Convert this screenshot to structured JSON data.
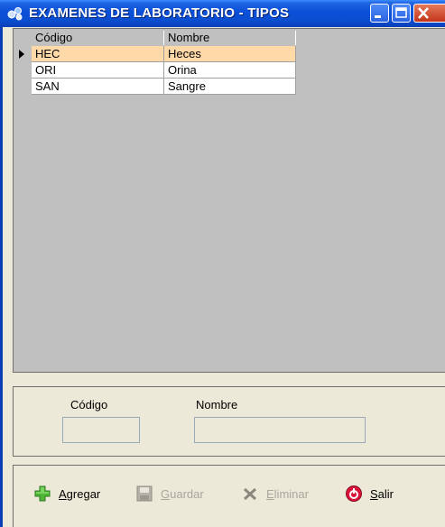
{
  "window": {
    "title": "EXAMENES DE LABORATORIO - TIPOS"
  },
  "grid": {
    "columns": [
      "Código",
      "Nombre"
    ],
    "rows": [
      {
        "codigo": "HEC",
        "nombre": "Heces",
        "selected": true
      },
      {
        "codigo": "ORI",
        "nombre": "Orina",
        "selected": false
      },
      {
        "codigo": "SAN",
        "nombre": "Sangre",
        "selected": false
      }
    ]
  },
  "form": {
    "codigo_label": "Código",
    "codigo_value": "",
    "nombre_label": "Nombre",
    "nombre_value": ""
  },
  "actions": {
    "agregar_first": "A",
    "agregar_rest": "gregar",
    "guardar_first": "G",
    "guardar_rest": "uardar",
    "eliminar_first": "E",
    "eliminar_rest": "liminar",
    "salir_first": "S",
    "salir_rest": "alir"
  },
  "colors": {
    "selected_row": "#ffd9a8",
    "title_bar": "#0a4fd8",
    "disabled_text": "#a8a79c"
  }
}
